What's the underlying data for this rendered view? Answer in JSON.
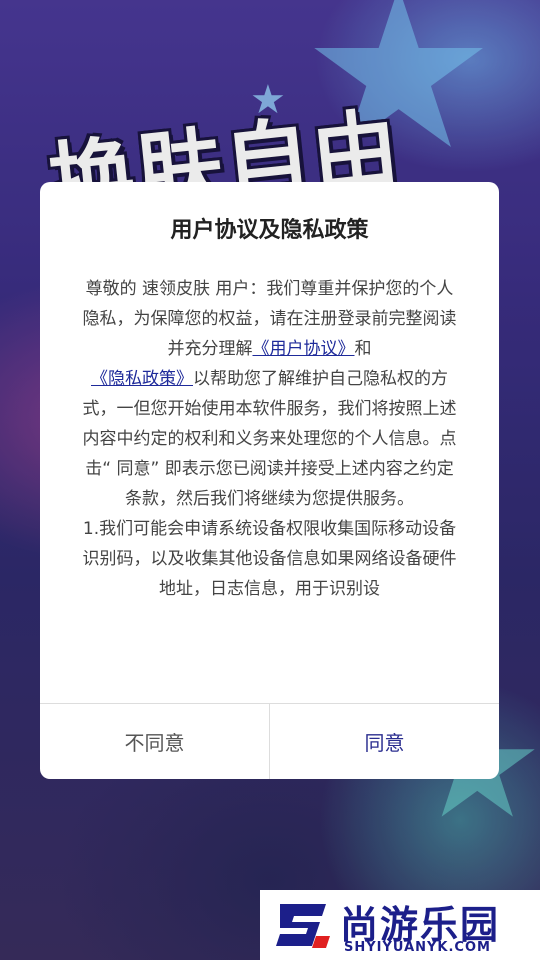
{
  "background": {
    "art_title": "换肤自由"
  },
  "dialog": {
    "title": "用户协议及隐私政策",
    "body": {
      "intro_prefix": "尊敬的 速领皮肤 用户：我们尊重并保护您的个人隐私，为保障您的权益，请在注册登录前完整阅读并充分理解",
      "user_agreement_link": "《用户协议》",
      "and_text": "和",
      "privacy_policy_link": "《隐私政策》",
      "intro_suffix": "以帮助您了解维护自己隐私权的方式，一但您开始使用本软件服务，我们将按照上述内容中约定的权利和义务来处理您的个人信息。点击“ 同意” 即表示您已阅读并接受上述内容之约定条款，然后我们将继续为您提供服务。",
      "clause_1": "1.我们可能会申请系统设备权限收集国际移动设备识别码，以及收集其他设备信息如果网络设备硬件地址，日志信息，用于识别设"
    },
    "buttons": {
      "disagree": "不同意",
      "agree": "同意"
    }
  },
  "watermark": {
    "brand": "尚游乐园",
    "site": "SHYIYUANYK.COM"
  },
  "colors": {
    "link": "#1e2a9a",
    "agree": "#2a2d8f",
    "brand": "#1c1f8a"
  }
}
